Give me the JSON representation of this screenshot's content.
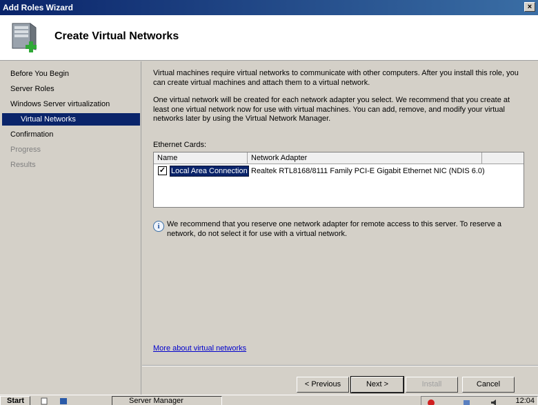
{
  "window": {
    "title": "Add Roles Wizard",
    "close_glyph": "×"
  },
  "header": {
    "title": "Create Virtual Networks",
    "icon": "server-add-icon"
  },
  "sidebar": {
    "items": [
      {
        "label": "Before You Begin",
        "state": "normal"
      },
      {
        "label": "Server Roles",
        "state": "normal"
      },
      {
        "label": "Windows Server virtualization",
        "state": "normal"
      },
      {
        "label": "Virtual Networks",
        "state": "selected"
      },
      {
        "label": "Confirmation",
        "state": "normal"
      },
      {
        "label": "Progress",
        "state": "disabled"
      },
      {
        "label": "Results",
        "state": "disabled"
      }
    ]
  },
  "main": {
    "para1": "Virtual machines require virtual networks to communicate with other computers. After you install this role, you can create virtual machines and attach them to a virtual network.",
    "para2": "One virtual network will be created for each network adapter you select. We recommend that you create at least one virtual network now for use with virtual machines. You can add, remove, and modify your virtual networks later by using the Virtual Network Manager.",
    "ethernet_label": "Ethernet Cards:",
    "table": {
      "columns": [
        "Name",
        "Network Adapter"
      ],
      "rows": [
        {
          "checked": true,
          "check_glyph": "✓",
          "name": "Local Area Connection",
          "adapter": "Realtek RTL8168/8111 Family PCI-E Gigabit Ethernet NIC (NDIS 6.0)"
        }
      ]
    },
    "info_text": "We recommend that you reserve one network adapter for remote access to this server. To reserve a network, do not select it for use with a virtual network.",
    "info_glyph": "i",
    "link": "More about virtual networks"
  },
  "buttons": {
    "previous": "< Previous",
    "next": "Next >",
    "install": "Install",
    "cancel": "Cancel"
  },
  "taskbar": {
    "start": "Start",
    "task": "Server Manager",
    "clock": "12:04"
  },
  "colors": {
    "title_bar": "#0a246a",
    "selection": "#0a246a",
    "link": "#0000cc",
    "dialog_bg": "#d4d0c8"
  }
}
